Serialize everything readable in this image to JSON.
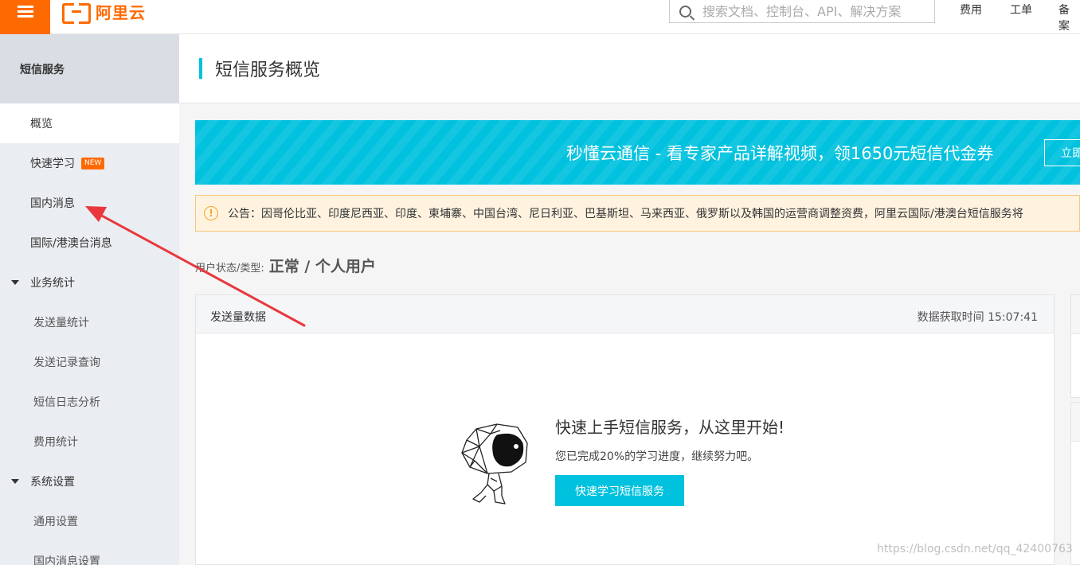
{
  "topbar": {
    "logo_text": "阿里云",
    "search_placeholder": "搜索文档、控制台、API、解决方案",
    "links": [
      "费用",
      "工单",
      "备案"
    ]
  },
  "sidebar": {
    "title": "短信服务",
    "items": [
      {
        "label": "概览",
        "active": true
      },
      {
        "label": "快速学习",
        "badge": "NEW"
      },
      {
        "label": "国内消息"
      },
      {
        "label": "国际/港澳台消息"
      },
      {
        "label": "业务统计",
        "expandable": true
      },
      {
        "label": "发送量统计"
      },
      {
        "label": "发送记录查询"
      },
      {
        "label": "短信日志分析"
      },
      {
        "label": "费用统计"
      },
      {
        "label": "系统设置",
        "expandable": true
      },
      {
        "label": "通用设置"
      },
      {
        "label": "国内消息设置"
      }
    ]
  },
  "main": {
    "page_title": "短信服务概览",
    "banner": {
      "text": "秒懂云通信 - 看专家产品详解视频，领1650元短信代金券",
      "button_label": "立即"
    },
    "notice": {
      "text": "公告：因哥伦比亚、印度尼西亚、印度、柬埔寨、中国台湾、尼日利亚、巴基斯坦、马来西亚、俄罗斯以及韩国的运营商调整资费，阿里云国际/港澳台短信服务将"
    },
    "user_status": {
      "label": "用户状态/类型:",
      "value": "正常 / 个人用户"
    },
    "send_card": {
      "title": "发送量数据",
      "time_label": "数据获取时间 15:07:41",
      "cta_title": "快速上手短信服务，从这里开始!",
      "cta_sub": "您已完成20%的学习进度，继续努力吧。",
      "cta_button": "快速学习短信服务"
    }
  },
  "watermark": "https://blog.csdn.net/qq_42400763",
  "colors": {
    "brand": "#ff6a00",
    "accent": "#00c1de",
    "annotation": "#e8383d"
  }
}
